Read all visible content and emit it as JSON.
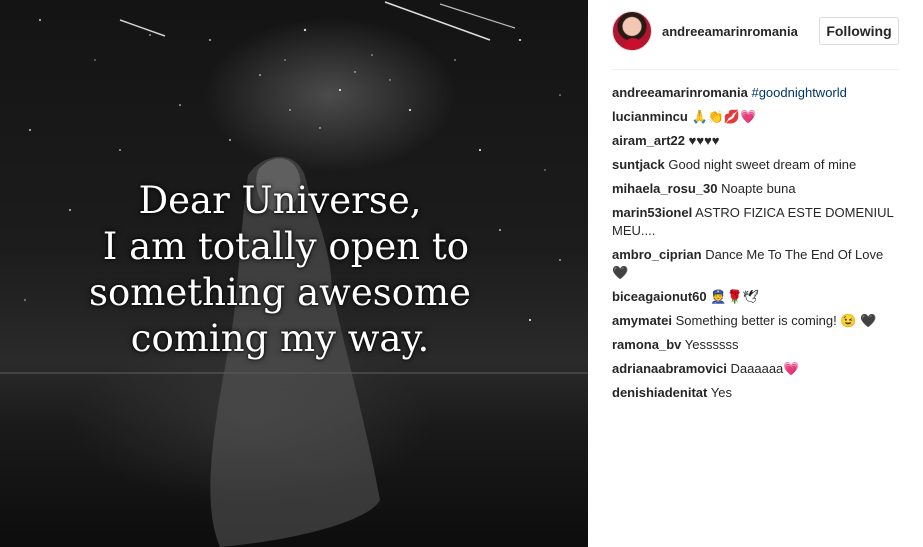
{
  "post": {
    "quote_lines": [
      "Dear Universe,",
      " I am totally open to",
      "something awesome",
      "coming my way."
    ]
  },
  "header": {
    "username": "andreeamarinromania",
    "follow_label": "Following"
  },
  "caption": {
    "user": "andreeamarinromania",
    "hashtag": "#goodnightworld"
  },
  "comments": [
    {
      "user": "lucianmincu",
      "text": "🙏👏💋💗"
    },
    {
      "user": "airam_art22",
      "text": "♥♥♥♥"
    },
    {
      "user": "suntjack",
      "text": "Good night sweet dream of mine"
    },
    {
      "user": "mihaela_rosu_30",
      "text": "Noapte buna"
    },
    {
      "user": "marin53ionel",
      "text": "ASTRO FIZICA ESTE DOMENIUL MEU...."
    },
    {
      "user": "ambro_ciprian",
      "text": "Dance Me To The End Of Love 🖤"
    },
    {
      "user": "biceagaionut60",
      "text": "👮🌹🕊"
    },
    {
      "user": "amymatei",
      "text": "Something better is coming! 😉 🖤"
    },
    {
      "user": "ramona_bv",
      "text": "Yessssss"
    },
    {
      "user": "adrianaabramovici",
      "text": "Daaaaaa💗"
    },
    {
      "user": "denishiadenitat",
      "text": "Yes"
    }
  ],
  "colors": {
    "link": "#003569",
    "text": "#262626",
    "border": "#dbdbdb"
  }
}
